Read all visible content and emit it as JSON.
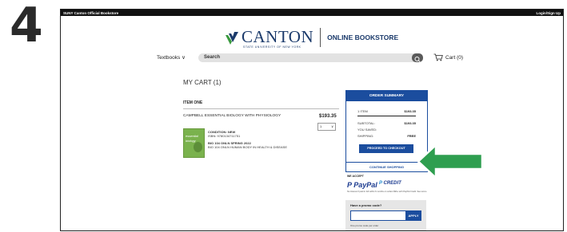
{
  "step_number": "4",
  "topbar": {
    "store_name": "SUNY Canton Official Bookstore",
    "login": "Login/Sign Up"
  },
  "brand": {
    "name": "CANTON",
    "tagline": "STATE UNIVERSITY OF NEW YORK",
    "online": "ONLINE BOOKSTORE",
    "colors": {
      "navy": "#1b3a6b",
      "green": "#3a9a3e"
    }
  },
  "nav": {
    "textbooks": "Textbooks ∨"
  },
  "search": {
    "placeholder": "Search"
  },
  "cart": {
    "label": "Cart (0)"
  },
  "page": {
    "title": "MY CART (1)",
    "section": "ITEM ONE",
    "item": {
      "title": "CAMPBELL ESSENTIAL BIOLOGY WITH PHYSIOLOGY",
      "price": "$193.35",
      "quantity": "1",
      "condition": "CONDITION: NEW",
      "isbn": "ISBN: 9780134711751",
      "course": "BIO 104 ONLN  SPRING 2022",
      "course_desc": "BIO 104 ONLN HUMAN BODY IN HEALTH & DISEASE",
      "cover_text": [
        "essential",
        "biology"
      ]
    }
  },
  "summary": {
    "header": "ORDER SUMMARY",
    "items_label": "1 ITEM",
    "items_value": "$193.35",
    "subtotal_label": "SUBTOTAL:",
    "subtotal_value": "$193.35",
    "saved_label": "YOU SAVED:",
    "shipping_label": "SHIPPING:",
    "shipping_value": "FREE",
    "checkout": "PROCEED TO CHECKOUT",
    "continue": "CONTINUE SHOPPING"
  },
  "payments": {
    "accept_label": "WE ACCEPT",
    "paypal": "PayPal",
    "credit": "CREDIT",
    "disclaimer": "No Interest if paid in full within 6 months on orders $99+ with PayPal Credit. See terms."
  },
  "promo": {
    "question": "Have a promo code?",
    "apply": "APPLY",
    "note": "One promo code per order"
  }
}
